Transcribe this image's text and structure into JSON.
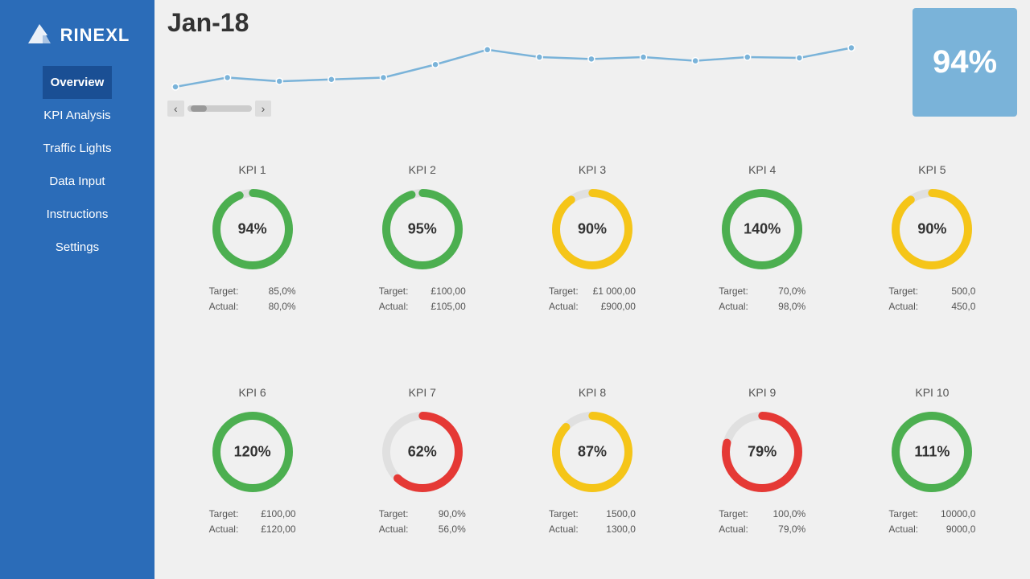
{
  "sidebar": {
    "logo_text": "RINEXL",
    "items": [
      {
        "id": "overview",
        "label": "Overview",
        "active": true
      },
      {
        "id": "kpi-analysis",
        "label": "KPI Analysis",
        "active": false
      },
      {
        "id": "traffic-lights",
        "label": "Traffic Lights",
        "active": false
      },
      {
        "id": "data-input",
        "label": "Data Input",
        "active": false
      },
      {
        "id": "instructions",
        "label": "Instructions",
        "active": false
      },
      {
        "id": "settings",
        "label": "Settings",
        "active": false
      }
    ]
  },
  "header": {
    "month": "Jan-18",
    "overall_percent": "94%"
  },
  "kpis": [
    {
      "id": "kpi1",
      "title": "KPI 1",
      "percent": 94,
      "label": "94%",
      "color": "#4caf50",
      "bg": "#e0e0e0",
      "target_label": "Target:",
      "target_value": "85,0%",
      "actual_label": "Actual:",
      "actual_value": "80,0%"
    },
    {
      "id": "kpi2",
      "title": "KPI 2",
      "percent": 95,
      "label": "95%",
      "color": "#4caf50",
      "bg": "#e0e0e0",
      "target_label": "Target:",
      "target_value": "£100,00",
      "actual_label": "Actual:",
      "actual_value": "£105,00"
    },
    {
      "id": "kpi3",
      "title": "KPI 3",
      "percent": 90,
      "label": "90%",
      "color": "#f5c518",
      "bg": "#e0e0e0",
      "target_label": "Target:",
      "target_value": "£1 000,00",
      "actual_label": "Actual:",
      "actual_value": "£900,00"
    },
    {
      "id": "kpi4",
      "title": "KPI 4",
      "percent": 100,
      "label": "140%",
      "color": "#4caf50",
      "bg": "#e0e0e0",
      "target_label": "Target:",
      "target_value": "70,0%",
      "actual_label": "Actual:",
      "actual_value": "98,0%"
    },
    {
      "id": "kpi5",
      "title": "KPI 5",
      "percent": 90,
      "label": "90%",
      "color": "#f5c518",
      "bg": "#e0e0e0",
      "target_label": "Target:",
      "target_value": "500,0",
      "actual_label": "Actual:",
      "actual_value": "450,0"
    },
    {
      "id": "kpi6",
      "title": "KPI 6",
      "percent": 100,
      "label": "120%",
      "color": "#4caf50",
      "bg": "#e0e0e0",
      "target_label": "Target:",
      "target_value": "£100,00",
      "actual_label": "Actual:",
      "actual_value": "£120,00"
    },
    {
      "id": "kpi7",
      "title": "KPI 7",
      "percent": 62,
      "label": "62%",
      "color": "#e53935",
      "bg": "#e0e0e0",
      "target_label": "Target:",
      "target_value": "90,0%",
      "actual_label": "Actual:",
      "actual_value": "56,0%"
    },
    {
      "id": "kpi8",
      "title": "KPI 8",
      "percent": 87,
      "label": "87%",
      "color": "#f5c518",
      "bg": "#e0e0e0",
      "target_label": "Target:",
      "target_value": "1500,0",
      "actual_label": "Actual:",
      "actual_value": "1300,0"
    },
    {
      "id": "kpi9",
      "title": "KPI 9",
      "percent": 79,
      "label": "79%",
      "color": "#e53935",
      "bg": "#e0e0e0",
      "target_label": "Target:",
      "target_value": "100,0%",
      "actual_label": "Actual:",
      "actual_value": "79,0%"
    },
    {
      "id": "kpi10",
      "title": "KPI 10",
      "percent": 100,
      "label": "111%",
      "color": "#4caf50",
      "bg": "#e0e0e0",
      "target_label": "Target:",
      "target_value": "10000,0",
      "actual_label": "Actual:",
      "actual_value": "9000,0"
    }
  ],
  "chart": {
    "points": [
      430,
      455,
      445,
      450,
      455,
      490,
      530,
      510,
      505,
      510,
      500,
      510,
      508,
      535
    ],
    "color": "#7ab3d9"
  }
}
